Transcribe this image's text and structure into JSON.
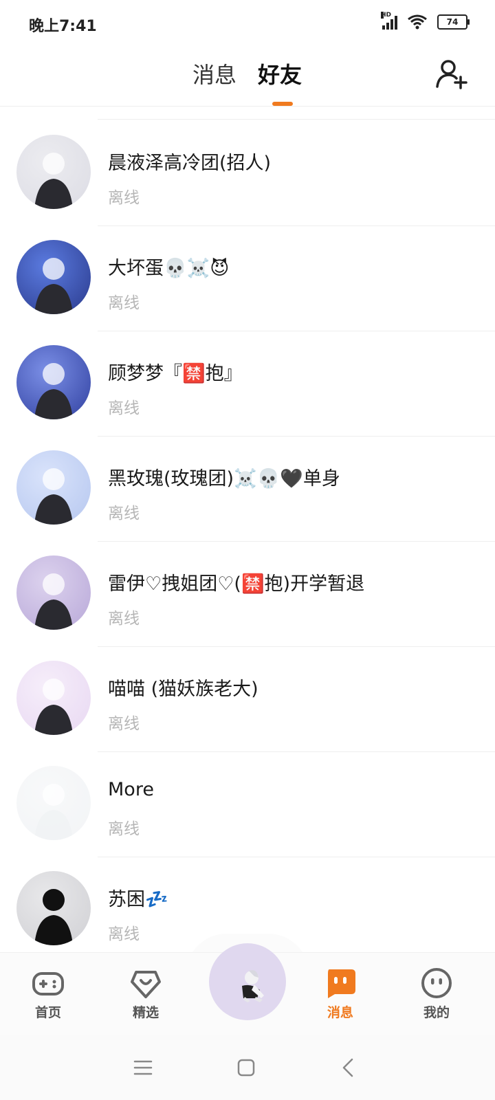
{
  "status_bar": {
    "time": "晚上7:41",
    "network": "HD",
    "battery": "74"
  },
  "header": {
    "tab_messages": "消息",
    "tab_friends": "好友",
    "active_tab": "好友"
  },
  "friends": [
    {
      "name": "晨液泽高冷团(招人)",
      "status": "离线",
      "avatar_colors": [
        "#ececf0",
        "#dcdce4"
      ]
    },
    {
      "name": "大坏蛋💀☠️😈",
      "status": "离线",
      "avatar_colors": [
        "#5b7be0",
        "#2a3a8c"
      ]
    },
    {
      "name": "顾梦梦『🈲抱』",
      "status": "离线",
      "avatar_colors": [
        "#7b8fe6",
        "#3040a0"
      ]
    },
    {
      "name": "黑玫瑰(玫瑰团)☠️💀🖤单身",
      "status": "离线",
      "avatar_colors": [
        "#d9e3fb",
        "#b6c7ef"
      ]
    },
    {
      "name": "雷伊♡拽姐团♡(🈲抱)开学暂退",
      "status": "离线",
      "avatar_colors": [
        "#dcd2ee",
        "#b8a8d8"
      ]
    },
    {
      "name": "喵喵 (猫妖族老大)",
      "status": "离线",
      "avatar_colors": [
        "#f6eefa",
        "#e8d8f2"
      ]
    },
    {
      "name": "More",
      "status": "离线",
      "avatar_colors": [
        "#f8f9fa",
        "#f2f4f6"
      ]
    },
    {
      "name": "苏困💤",
      "status": "离线",
      "avatar_colors": [
        "#e8e8ea",
        "#d0d0d4"
      ]
    }
  ],
  "bottom_nav": {
    "items": [
      {
        "label": "首页",
        "icon": "gamepad-icon"
      },
      {
        "label": "精选",
        "icon": "heart-shield-icon"
      },
      {
        "label": "消息",
        "icon": "message-face-icon",
        "active": true
      },
      {
        "label": "我的",
        "icon": "face-icon"
      }
    ],
    "center_icon": "avatar-center-icon"
  },
  "colors": {
    "accent": "#f07a1f",
    "text_primary": "#1a1a1a",
    "text_secondary": "#b6b6b6",
    "divider": "#eeeeee"
  }
}
